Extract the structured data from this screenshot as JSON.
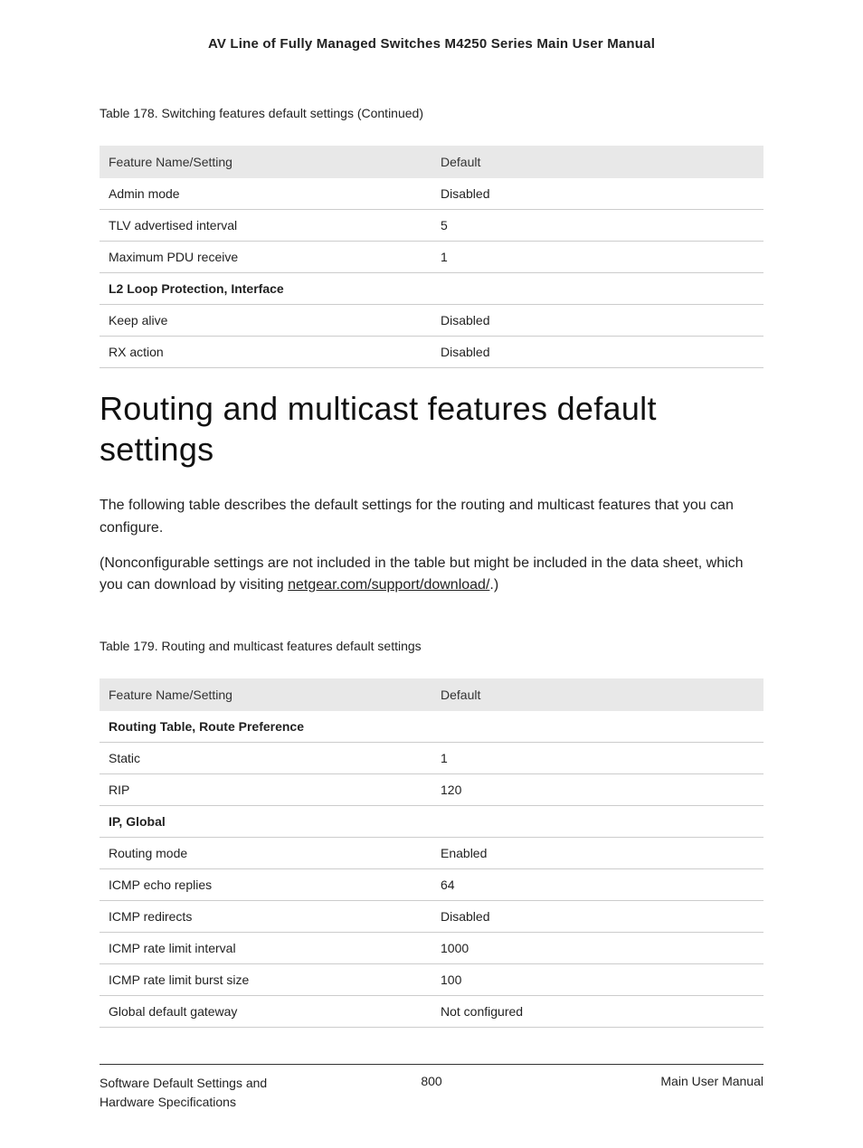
{
  "header": {
    "title": "AV Line of Fully Managed Switches M4250 Series Main User Manual"
  },
  "table178": {
    "caption": "Table 178. Switching features default settings (Continued)",
    "col1": "Feature Name/Setting",
    "col2": "Default",
    "rows": [
      {
        "name": "Admin mode",
        "value": "Disabled",
        "bold": false
      },
      {
        "name": "TLV advertised interval",
        "value": "5",
        "bold": false
      },
      {
        "name": "Maximum PDU receive",
        "value": "1",
        "bold": false
      },
      {
        "name": "L2 Loop Protection, Interface",
        "value": "",
        "bold": true
      },
      {
        "name": "Keep alive",
        "value": "Disabled",
        "bold": false
      },
      {
        "name": "RX action",
        "value": "Disabled",
        "bold": false
      }
    ]
  },
  "section": {
    "heading": "Routing and multicast features default settings",
    "para1": "The following table describes the default settings for the routing and multicast features that you can configure.",
    "para2_pre": "(Nonconfigurable settings are not included in the table but might be included in the data sheet, which you can download by visiting ",
    "para2_link": "netgear.com/support/download/",
    "para2_post": ".)"
  },
  "table179": {
    "caption": "Table 179. Routing and multicast features default settings",
    "col1": "Feature Name/Setting",
    "col2": "Default",
    "rows": [
      {
        "name": "Routing Table, Route Preference",
        "value": "",
        "bold": true
      },
      {
        "name": "Static",
        "value": "1",
        "bold": false
      },
      {
        "name": "RIP",
        "value": "120",
        "bold": false
      },
      {
        "name": "IP, Global",
        "value": "",
        "bold": true
      },
      {
        "name": "Routing mode",
        "value": "Enabled",
        "bold": false
      },
      {
        "name": "ICMP echo replies",
        "value": "64",
        "bold": false
      },
      {
        "name": "ICMP redirects",
        "value": "Disabled",
        "bold": false
      },
      {
        "name": "ICMP rate limit interval",
        "value": "1000",
        "bold": false
      },
      {
        "name": "ICMP rate limit burst size",
        "value": "100",
        "bold": false
      },
      {
        "name": "Global default gateway",
        "value": "Not configured",
        "bold": false
      }
    ]
  },
  "footer": {
    "left": "Software Default Settings and Hardware Specifications",
    "center": "800",
    "right": "Main User Manual"
  }
}
